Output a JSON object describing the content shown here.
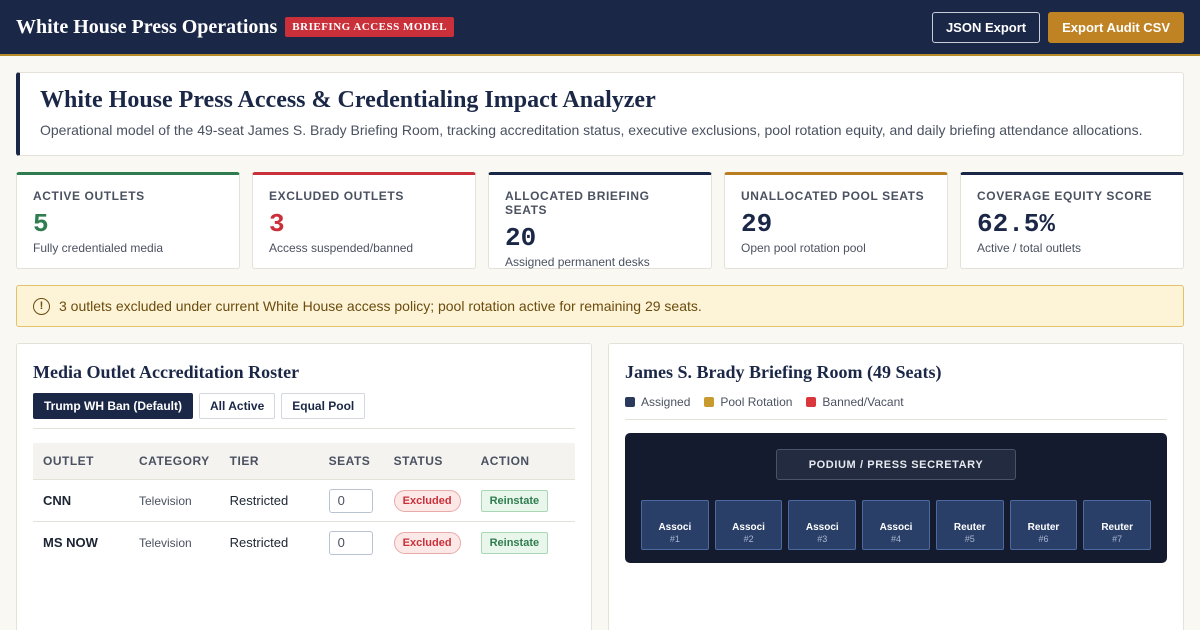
{
  "header": {
    "brand": "White House Press Operations",
    "model_badge": "BRIEFING ACCESS MODEL",
    "json_export_label": "JSON Export",
    "csv_export_label": "Export Audit CSV"
  },
  "hero": {
    "title": "White House Press Access & Credentialing Impact Analyzer",
    "description": "Operational model of the 49-seat James S. Brady Briefing Room, tracking accreditation status, executive exclusions, pool rotation equity, and daily briefing attendance allocations."
  },
  "stats": [
    {
      "label": "ACTIVE OUTLETS",
      "value": "5",
      "sub": "Fully credentialed media"
    },
    {
      "label": "EXCLUDED OUTLETS",
      "value": "3",
      "sub": "Access suspended/banned"
    },
    {
      "label": "ALLOCATED BRIEFING SEATS",
      "value": "20",
      "sub": "Assigned permanent desks"
    },
    {
      "label": "UNALLOCATED POOL SEATS",
      "value": "29",
      "sub": "Open pool rotation pool"
    },
    {
      "label": "COVERAGE EQUITY SCORE",
      "value": "62.5%",
      "sub": "Active / total outlets"
    }
  ],
  "alert": {
    "icon": "info-icon",
    "text": "3 outlets excluded under current White House access policy; pool rotation active for remaining 29 seats."
  },
  "roster": {
    "title": "Media Outlet Accreditation Roster",
    "presets": [
      "Trump WH Ban (Default)",
      "All Active",
      "Equal Pool"
    ],
    "columns": [
      "OUTLET",
      "CATEGORY",
      "TIER",
      "SEATS",
      "STATUS",
      "ACTION"
    ],
    "rows": [
      {
        "outlet": "CNN",
        "category": "Television",
        "tier": "Restricted",
        "seats": "0",
        "status": "Excluded",
        "action": "Reinstate"
      },
      {
        "outlet": "MS NOW",
        "category": "Television",
        "tier": "Restricted",
        "seats": "0",
        "status": "Excluded",
        "action": "Reinstate"
      }
    ]
  },
  "room": {
    "title": "James S. Brady Briefing Room (49 Seats)",
    "legend": [
      {
        "label": "Assigned",
        "color": "#2b3a5c"
      },
      {
        "label": "Pool Rotation",
        "color": "#c99a2e"
      },
      {
        "label": "Banned/Vacant",
        "color": "#d9363e"
      }
    ],
    "podium": "PODIUM / PRESS SECRETARY",
    "seats": [
      {
        "name": "Associ",
        "num": "#1"
      },
      {
        "name": "Associ",
        "num": "#2"
      },
      {
        "name": "Associ",
        "num": "#3"
      },
      {
        "name": "Associ",
        "num": "#4"
      },
      {
        "name": "Reuter",
        "num": "#5"
      },
      {
        "name": "Reuter",
        "num": "#6"
      },
      {
        "name": "Reuter",
        "num": "#7"
      }
    ]
  }
}
